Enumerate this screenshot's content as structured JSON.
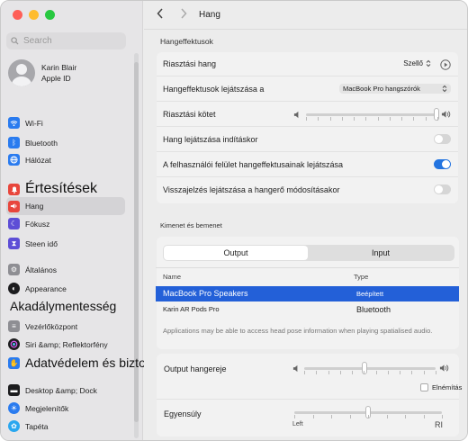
{
  "window": {
    "traffic_lights": {
      "close": "#fe5f57",
      "minimize": "#febc2e",
      "zoom": "#28c840"
    }
  },
  "search": {
    "placeholder": "Search"
  },
  "user": {
    "name": "Karin Blair",
    "subtitle": "Apple ID"
  },
  "sidebar": {
    "items": [
      {
        "label": "Wi‑Fi",
        "icon": "wifi-icon",
        "color": "#2a7bef"
      },
      {
        "label": "Bluetooth",
        "icon": "bluetooth-icon",
        "color": "#2a7bef"
      },
      {
        "label": "Hálózat",
        "icon": "globe-icon",
        "color": "#2a7bef"
      },
      {
        "label": "Értesítések",
        "icon": "bell-icon",
        "color": "#e8463c"
      },
      {
        "label": "Hang",
        "icon": "speaker-icon",
        "color": "#e8463c"
      },
      {
        "label": "Fókusz",
        "icon": "moon-icon",
        "color": "#5d4ed6"
      },
      {
        "label": "Steen idő",
        "icon": "hourglass-icon",
        "color": "#5d4ed6"
      },
      {
        "label": "Általános",
        "icon": "gear-icon",
        "color": "#8e8e93"
      },
      {
        "label": "Appearance",
        "icon": "appearance-icon",
        "color": "#1c1c1e"
      },
      {
        "label": "Akadálymentesség",
        "icon": "",
        "color": ""
      },
      {
        "label": "Vezérlőközpont",
        "icon": "control-center-icon",
        "color": "#8e8e93"
      },
      {
        "label": "Siri &amp; Reflektorfény",
        "icon": "siri-icon",
        "color": "#1c1c1e"
      },
      {
        "label": "Adatvédelem és biztonság",
        "icon": "hand-icon",
        "color": "#2a7bef"
      },
      {
        "label": "Desktop &amp; Dock",
        "icon": "dock-icon",
        "color": "#1c1c1e"
      },
      {
        "label": "Megjelenítők",
        "icon": "display-icon",
        "color": "#2a7bef"
      },
      {
        "label": "Tapéta",
        "icon": "wallpaper-icon",
        "color": "#2aa7ef"
      }
    ]
  },
  "main": {
    "title": "Hang",
    "sound_effects_header": "Hangeffektusok",
    "alert_sound_label": "Riasztási hang",
    "alert_sound_value": "Szellő",
    "play_effects_through_label": "Hangeffektusok lejátszása a",
    "play_effects_through_value": "MacBook Pro hangszórók",
    "alert_volume_label": "Riasztási kötet",
    "startup_sound_label": "Hang lejátszása indításkor",
    "ui_sound_effects_label": "A felhasználói felület hangeffektusainak lejátszása",
    "volume_feedback_label": "Visszajelzés lejátszása a hangerő módosításakor",
    "output_input_header": "Kimenet és bemenet",
    "tab_output": "Output",
    "tab_input": "Input",
    "col_name": "Name",
    "col_type": "Type",
    "devices": [
      {
        "name": "MacBook Pro Speakers",
        "type": "Beépített"
      },
      {
        "name": "Karin AR Pods Pro",
        "type": "Bluetooth"
      }
    ],
    "spatial_note": "Applications may be able to access head pose information when playing spatialised audio.",
    "output_volume_label": "Output hangereje",
    "mute_label": "Elnémítás",
    "balance_label": "Egyensúly",
    "balance_left": "Left",
    "balance_right": "RI",
    "accent": "#2360d8"
  },
  "state": {
    "alert_volume": 0.99,
    "output_volume": 0.46,
    "balance": 0.5,
    "startup_sound": false,
    "ui_sound_effects": true,
    "volume_feedback": false,
    "mute": false
  }
}
